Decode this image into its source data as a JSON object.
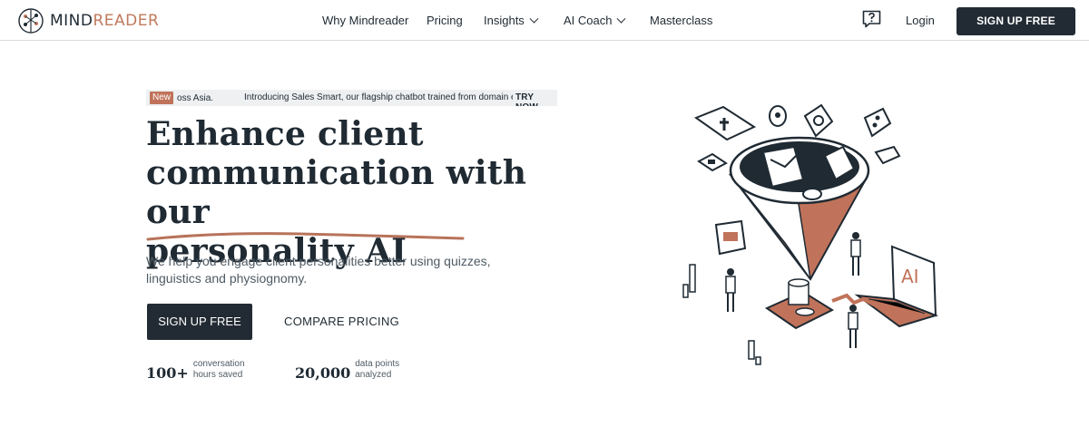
{
  "brand": {
    "name_part1": "MIND",
    "name_part2": "READER"
  },
  "nav": {
    "items": [
      {
        "label": "Why Mindreader",
        "has_dropdown": false
      },
      {
        "label": "Pricing",
        "has_dropdown": false
      },
      {
        "label": "Insights",
        "has_dropdown": true
      },
      {
        "label": "AI Coach",
        "has_dropdown": true
      },
      {
        "label": "Masterclass",
        "has_dropdown": false
      }
    ],
    "help_icon": "question-chat-icon",
    "login": "Login",
    "cta": "SIGN UP FREE"
  },
  "announcement": {
    "badge": "New",
    "text_prev": "oss Asia.",
    "text": "Introducing Sales Smart, our flagship chatbot trained from domain experts across Asia.",
    "action": "TRY NOW"
  },
  "hero": {
    "headline_line1": "Enhance client",
    "headline_line2": "communication with our",
    "headline_line3": "personality AI",
    "subtext": "We help you engage client personalities better using quizzes, linguistics and physiognomy.",
    "primary_cta": "SIGN UP FREE",
    "secondary_cta": "COMPARE PRICING",
    "stats": [
      {
        "value": "100+",
        "label": "conversation hours saved"
      },
      {
        "value": "20,000",
        "label": "data points analyzed"
      }
    ]
  },
  "colors": {
    "accent": "#c0735a",
    "dark": "#222b33",
    "text": "#1f2a33",
    "muted": "#4e5a63"
  }
}
